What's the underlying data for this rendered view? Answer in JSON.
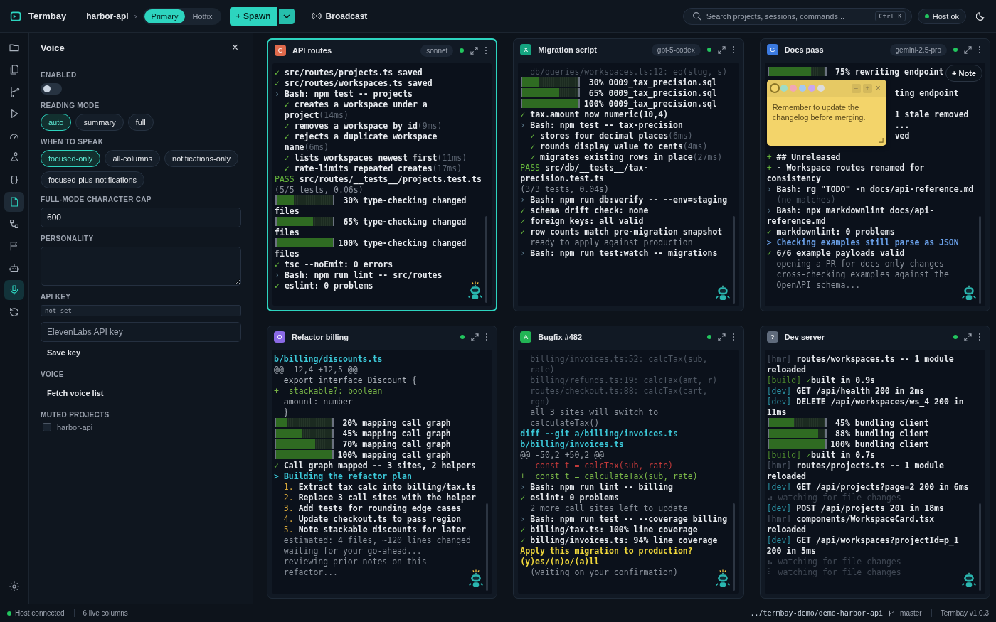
{
  "app": {
    "name": "Termbay",
    "project": "harbor-api",
    "chevron": "›",
    "branches": [
      {
        "label": "Primary",
        "selected": true
      },
      {
        "label": "Hotfix",
        "selected": false
      }
    ],
    "spawn": "+ Spawn",
    "broadcast": "Broadcast",
    "search": {
      "placeholder": "Search projects, sessions, commands...",
      "shortcut": "Ctrl K"
    },
    "host": "Host ok"
  },
  "rail": [
    {
      "selected": false,
      "active": false
    },
    {
      "selected": false,
      "active": false
    },
    {
      "selected": false,
      "active": false
    },
    {
      "selected": false,
      "active": false
    },
    {
      "selected": false,
      "active": false
    },
    {
      "selected": false,
      "active": false
    },
    {
      "selected": false,
      "active": false
    },
    {
      "selected": false,
      "active": true
    },
    {
      "selected": false,
      "active": false
    },
    {
      "selected": false,
      "active": false
    },
    {
      "selected": false,
      "active": false
    },
    {
      "selected": true,
      "active": false
    },
    {
      "selected": false,
      "active": false
    }
  ],
  "voice": {
    "title": "Voice",
    "close": "×",
    "enabled": {
      "label": "ENABLED",
      "on": false
    },
    "reading_mode": {
      "label": "READING MODE",
      "options": [
        {
          "label": "auto",
          "selected": true
        },
        {
          "label": "summary",
          "selected": false
        },
        {
          "label": "full",
          "selected": false
        }
      ]
    },
    "when_to_speak": {
      "label": "WHEN TO SPEAK",
      "options": [
        {
          "label": "focused-only",
          "selected": true
        },
        {
          "label": "all-columns",
          "selected": false
        },
        {
          "label": "notifications-only",
          "selected": false
        },
        {
          "label": "focused-plus-notifications",
          "selected": false
        }
      ]
    },
    "char_cap": {
      "label": "FULL-MODE CHARACTER CAP",
      "value": "600"
    },
    "personality": {
      "label": "PERSONALITY"
    },
    "api_key": {
      "label": "API KEY",
      "status": "not set",
      "placeholder": "ElevenLabs API key",
      "button": "Save key"
    },
    "voice_list": {
      "label": "VOICE",
      "button": "Fetch voice list"
    },
    "muted": {
      "label": "MUTED PROJECTS",
      "items": [
        {
          "label": "harbor-api",
          "checked": false
        }
      ]
    }
  },
  "panels": [
    {
      "badge": "C",
      "color": "#e06a4c",
      "title": "API routes",
      "model": "sonnet",
      "selected": true,
      "robot_alert": true,
      "lines": [
        {
          "kind": "ok",
          "mark": "✓",
          "text": "src/routes/projects.ts saved"
        },
        {
          "kind": "ok",
          "mark": "✓",
          "text": "src/routes/workspaces.ts saved"
        },
        {
          "kind": "cmd",
          "mark": "›",
          "text": "Bash: npm test -- projects"
        },
        {
          "kind": "ok",
          "mark": "✓",
          "text": "creates a workspace under a project",
          "note": "(14ms)",
          "indent": true
        },
        {
          "kind": "ok",
          "mark": "✓",
          "text": "removes a workspace by id",
          "note": "(9ms)",
          "indent": true
        },
        {
          "kind": "ok",
          "mark": "✓",
          "text": "rejects a duplicate workspace name",
          "note": "(6ms)",
          "indent": true
        },
        {
          "kind": "ok",
          "mark": "✓",
          "text": "lists workspaces newest first",
          "note": "(11ms)",
          "indent": true
        },
        {
          "kind": "ok",
          "mark": "✓",
          "text": "rate-limits repeated creates",
          "note": "(17ms)",
          "indent": true
        },
        {
          "kind": "pass",
          "mark": "PASS",
          "text": "src/routes/__tests__/projects.test.ts"
        },
        {
          "kind": "dim",
          "text": "(5/5 tests, 0.06s)"
        },
        {
          "kind": "progress",
          "level": 0.3,
          "pct": "30%",
          "text": "type-checking changed files"
        },
        {
          "kind": "progress",
          "level": 0.65,
          "pct": "65%",
          "text": "type-checking changed files"
        },
        {
          "kind": "progress",
          "level": 1,
          "pct": "100%",
          "text": "type-checking changed files"
        },
        {
          "kind": "ok",
          "mark": "✓",
          "text": "tsc --noEmit: 0 errors"
        },
        {
          "kind": "cmd",
          "mark": "›",
          "text": "Bash: npm run lint -- src/routes"
        },
        {
          "kind": "ok",
          "mark": "✓",
          "text": "eslint: 0 problems"
        }
      ]
    },
    {
      "badge": "X",
      "color": "#14a37f",
      "title": "Migration script",
      "model": "gpt-5-codex",
      "selected": false,
      "robot_alert": false,
      "lines": [
        {
          "kind": "faint",
          "text": "db/queries/workspaces.ts:12: eq(slug, s)",
          "indent": true
        },
        {
          "kind": "progress",
          "level": 0.3,
          "pct": "30%",
          "text": "0009_tax_precision.sql"
        },
        {
          "kind": "progress",
          "level": 0.65,
          "pct": "65%",
          "text": "0009_tax_precision.sql"
        },
        {
          "kind": "progress",
          "level": 1,
          "pct": "100%",
          "text": "0009_tax_precision.sql"
        },
        {
          "kind": "ok",
          "mark": "✓",
          "text": "tax.amount now numeric(10,4)"
        },
        {
          "kind": "cmd",
          "mark": "›",
          "text": "Bash: npm test -- tax-precision"
        },
        {
          "kind": "ok",
          "mark": "✓",
          "text": "stores four decimal places",
          "note": "(6ms)",
          "indent": true
        },
        {
          "kind": "ok",
          "mark": "✓",
          "text": "rounds display value to cents",
          "note": "(4ms)",
          "indent": true
        },
        {
          "kind": "ok",
          "mark": "✓",
          "text": "migrates existing rows in place",
          "note": "(27ms)",
          "indent": true
        },
        {
          "kind": "pass",
          "mark": "PASS",
          "text": "src/db/__tests__/tax-precision.test.ts"
        },
        {
          "kind": "dim",
          "text": "(3/3 tests, 0.04s)"
        },
        {
          "kind": "cmd",
          "mark": "›",
          "text": "Bash: npm run db:verify -- --env=staging"
        },
        {
          "kind": "ok",
          "mark": "✓",
          "text": "schema drift check: none"
        },
        {
          "kind": "ok",
          "mark": "✓",
          "text": "foreign keys: all valid"
        },
        {
          "kind": "ok",
          "mark": "✓",
          "text": "row counts match pre-migration snapshot"
        },
        {
          "kind": "dim",
          "text": "ready to apply against production",
          "indent": true
        },
        {
          "kind": "cmd",
          "mark": "›",
          "text": "Bash: npm run test:watch -- migrations"
        }
      ]
    },
    {
      "badge": "G",
      "color": "#3b7ae0",
      "title": "Docs pass",
      "model": "gemini-2.5-pro",
      "selected": false,
      "robot_alert": false,
      "note_button": "+ Note",
      "note": {
        "swatches": [
          {
            "color": "#f3d46a",
            "selected": true
          },
          {
            "color": "#9fdcc7",
            "selected": false
          },
          {
            "color": "#f1a7b5",
            "selected": false
          },
          {
            "color": "#a5c8f0",
            "selected": false
          },
          {
            "color": "#c9a6ef",
            "selected": false
          },
          {
            "color": "#dcdcdc",
            "selected": false
          }
        ],
        "minimize": "–",
        "expand": "+",
        "close": "×",
        "text": "Remember to update the changelog before merging."
      },
      "lines": [
        {
          "kind": "progress",
          "level": 0.75,
          "pct": "75%",
          "text": "rewriting endpoint"
        },
        {
          "kind": "gap"
        },
        {
          "kind": "behind",
          "text": "ting endpoint"
        },
        {
          "kind": "gap"
        },
        {
          "kind": "behind",
          "text": "1 stale removed"
        },
        {
          "kind": "behind",
          "text": "..."
        },
        {
          "kind": "behind",
          "text": "ved"
        },
        {
          "kind": "gap"
        },
        {
          "kind": "changelog",
          "mark": "+",
          "text": "## Unreleased"
        },
        {
          "kind": "changelog",
          "mark": "+",
          "text": "- Workspace routes renamed for consistency"
        },
        {
          "kind": "cmd",
          "mark": "›",
          "text": "Bash: rg \"TODO\" -n docs/api-reference.md"
        },
        {
          "kind": "faint",
          "text": "(no matches)",
          "indent": true
        },
        {
          "kind": "cmd",
          "mark": "›",
          "text": "Bash: npx markdownlint docs/api-reference.md"
        },
        {
          "kind": "ok",
          "mark": "✓",
          "text": "markdownlint: 0 problems"
        },
        {
          "kind": "info",
          "mark": ">",
          "text": "Checking examples still parse as JSON"
        },
        {
          "kind": "ok",
          "mark": "✓",
          "text": "6/6 example payloads valid"
        },
        {
          "kind": "dim",
          "text": "opening a PR for docs-only changes",
          "indent": true
        },
        {
          "kind": "dim",
          "text": "cross-checking examples against the OpenAPI schema...",
          "indent": true
        }
      ]
    },
    {
      "badge": "O",
      "color": "#8b6ae6",
      "title": "Refactor billing",
      "selected": false,
      "robot_alert": true,
      "lines": [
        {
          "kind": "file",
          "text": "b/billing/discounts.ts"
        },
        {
          "kind": "hunk",
          "text": "@@ -12,4 +12,5 @@"
        },
        {
          "kind": "code",
          "text": "export interface Discount {",
          "indent": true
        },
        {
          "kind": "add",
          "mark": "+",
          "text": "stackable?: boolean"
        },
        {
          "kind": "code",
          "text": "amount: number",
          "indent": true
        },
        {
          "kind": "code",
          "text": "}",
          "indent": true
        },
        {
          "kind": "progress",
          "level": 0.2,
          "pct": "20%",
          "text": "mapping call graph"
        },
        {
          "kind": "progress",
          "level": 0.45,
          "pct": "45%",
          "text": "mapping call graph"
        },
        {
          "kind": "progress",
          "level": 0.7,
          "pct": "70%",
          "text": "mapping call graph"
        },
        {
          "kind": "progress",
          "level": 1,
          "pct": "100%",
          "text": "mapping call graph"
        },
        {
          "kind": "ok",
          "mark": "✓",
          "text": "Call graph mapped -- 3 sites, 2 helpers"
        },
        {
          "kind": "heading",
          "mark": ">",
          "text": "Building the refactor plan"
        },
        {
          "kind": "step",
          "mark": "1.",
          "text": "Extract tax calc into billing/tax.ts",
          "indent": true
        },
        {
          "kind": "step",
          "mark": "2.",
          "text": "Replace 3 call sites with the helper",
          "indent": true
        },
        {
          "kind": "step",
          "mark": "3.",
          "text": "Add tests for rounding edge cases",
          "indent": true
        },
        {
          "kind": "step",
          "mark": "4.",
          "text": "Update checkout.ts to pass region",
          "indent": true
        },
        {
          "kind": "step",
          "mark": "5.",
          "text": "Note stackable discounts for later",
          "indent": true
        },
        {
          "kind": "dim",
          "text": "estimated: 4 files, ~120 lines changed",
          "indent": true
        },
        {
          "kind": "dim",
          "text": "waiting for your go-ahead...",
          "indent": true
        },
        {
          "kind": "dim",
          "text": "reviewing prior notes on this refactor...",
          "indent": true
        }
      ]
    },
    {
      "badge": "A",
      "color": "#22b455",
      "title": "Bugfix #482",
      "selected": false,
      "robot_alert": true,
      "lines": [
        {
          "kind": "faint",
          "text": "billing/invoices.ts:52: calcTax(sub, rate)",
          "indent": true
        },
        {
          "kind": "faint",
          "text": "billing/refunds.ts:19: calcTax(amt, r)",
          "indent": true
        },
        {
          "kind": "faint",
          "text": "routes/checkout.ts:88: calcTax(cart, rgn)",
          "indent": true
        },
        {
          "kind": "dim",
          "text": "all 3 sites will switch to calculateTax()",
          "indent": true
        },
        {
          "kind": "file",
          "text": "diff --git a/billing/invoices.ts b/billing/invoices.ts"
        },
        {
          "kind": "hunk",
          "text": "@@ -50,2 +50,2 @@"
        },
        {
          "kind": "del",
          "mark": "-",
          "text": "const t = calcTax(sub, rate)"
        },
        {
          "kind": "add",
          "mark": "+",
          "text": "const t = calculateTax(sub, rate)"
        },
        {
          "kind": "cmd",
          "mark": "›",
          "text": "Bash: npm run lint -- billing"
        },
        {
          "kind": "ok",
          "mark": "✓",
          "text": "eslint: 0 problems"
        },
        {
          "kind": "dim",
          "text": "2 more call sites left to update",
          "indent": true
        },
        {
          "kind": "cmd",
          "mark": "›",
          "text": "Bash: npm run test -- --coverage billing"
        },
        {
          "kind": "ok",
          "mark": "✓",
          "text": "billing/tax.ts: 100% line coverage"
        },
        {
          "kind": "ok",
          "mark": "✓",
          "text": "billing/invoices.ts: 94% line coverage"
        },
        {
          "kind": "ask",
          "text": "Apply this migration to production? (y)es/(n)o/(a)ll"
        },
        {
          "kind": "dim",
          "text": "(waiting on your confirmation)",
          "indent": true
        }
      ]
    },
    {
      "badge": "?",
      "color": "#5f6b7c",
      "title": "Dev server",
      "selected": false,
      "robot_alert": false,
      "lines": [
        {
          "kind": "hmr",
          "mark": "[hmr]",
          "text": "routes/workspaces.ts -- 1 module reloaded"
        },
        {
          "kind": "build",
          "mark": "[build]",
          "sign": "✓",
          "text": "built in 0.9s"
        },
        {
          "kind": "dev",
          "mark": "[dev]",
          "text": "GET /api/health 200 in 2ms"
        },
        {
          "kind": "dev",
          "mark": "[dev]",
          "text": "DELETE /api/workspaces/ws_4 200 in 11ms"
        },
        {
          "kind": "progress",
          "level": 0.45,
          "pct": "45%",
          "text": "bundling client"
        },
        {
          "kind": "progress",
          "level": 0.88,
          "pct": "88%",
          "text": "bundling client"
        },
        {
          "kind": "progress",
          "level": 1,
          "pct": "100%",
          "text": "bundling client"
        },
        {
          "kind": "build",
          "mark": "[build]",
          "sign": "✓",
          "text": "built in 0.7s"
        },
        {
          "kind": "hmr",
          "mark": "[hmr]",
          "text": "routes/projects.ts -- 1 module reloaded"
        },
        {
          "kind": "dev",
          "mark": "[dev]",
          "text": "GET /api/projects?page=2 200 in 6ms"
        },
        {
          "kind": "spin",
          "mark": "⠴",
          "text": "watching for file changes"
        },
        {
          "kind": "dev",
          "mark": "[dev]",
          "text": "POST /api/projects 201 in 18ms"
        },
        {
          "kind": "hmr",
          "mark": "[hmr]",
          "text": "components/WorkspaceCard.tsx reloaded"
        },
        {
          "kind": "dev",
          "mark": "[dev]",
          "text": "GET /api/workspaces?projectId=p_1 200 in 5ms"
        },
        {
          "kind": "spin",
          "mark": "⠦",
          "text": "watching for file changes"
        },
        {
          "kind": "spin",
          "mark": "⠇",
          "text": "watching for file changes"
        }
      ]
    }
  ],
  "status_bar": {
    "connection": "Host connected",
    "columns": "6 live columns",
    "path": "../termbay-demo/demo-harbor-api",
    "branch": "master",
    "version": "Termbay v1.0.3"
  }
}
